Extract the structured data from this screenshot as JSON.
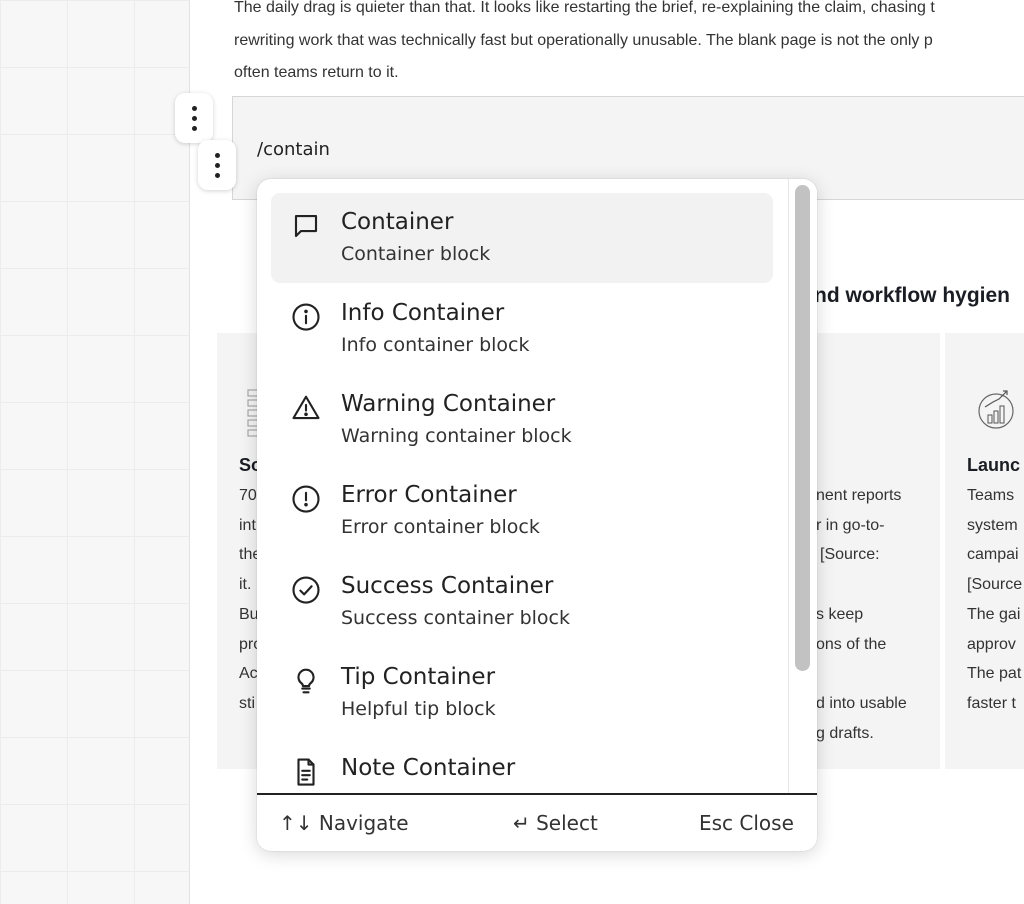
{
  "document": {
    "paragraph_lines": [
      "The daily drag is quieter than that. It looks like restarting the brief, re-explaining the claim, chasing t",
      "rewriting work that was technically fast but operationally unusable. The blank page is not the only p",
      "often teams return to it."
    ],
    "code_block_text": "/contain",
    "section_heading": "nd workflow hygien",
    "card_left": {
      "title": "So",
      "lines": [
        "70",
        "int",
        "the",
        "it.",
        "Bu",
        "pro",
        "Ac",
        "sti"
      ]
    },
    "card_middle": {
      "lines": [
        "nent reports",
        "r in go-to-",
        "[Source:",
        "",
        "s keep",
        "ons of the",
        "",
        "d into usable",
        "g drafts."
      ]
    },
    "card_right": {
      "title": "Launc",
      "lines": [
        "Teams",
        "system",
        "campai",
        "[Source",
        "The gai",
        "approv",
        "The pat",
        "faster t"
      ]
    }
  },
  "slash_menu": {
    "items": [
      {
        "title": "Container",
        "subtitle": "Container block",
        "icon": "message-square-icon",
        "active": true
      },
      {
        "title": "Info Container",
        "subtitle": "Info container block",
        "icon": "info-icon",
        "active": false
      },
      {
        "title": "Warning Container",
        "subtitle": "Warning container block",
        "icon": "warning-triangle-icon",
        "active": false
      },
      {
        "title": "Error Container",
        "subtitle": "Error container block",
        "icon": "error-circle-icon",
        "active": false
      },
      {
        "title": "Success Container",
        "subtitle": "Success container block",
        "icon": "check-circle-icon",
        "active": false
      },
      {
        "title": "Tip Container",
        "subtitle": "Helpful tip block",
        "icon": "lightbulb-icon",
        "active": false
      },
      {
        "title": "Note Container",
        "subtitle": "",
        "icon": "file-text-icon",
        "active": false
      }
    ],
    "footer": {
      "navigate": "↑↓ Navigate",
      "select": "↵ Select",
      "close": "Esc Close"
    }
  }
}
